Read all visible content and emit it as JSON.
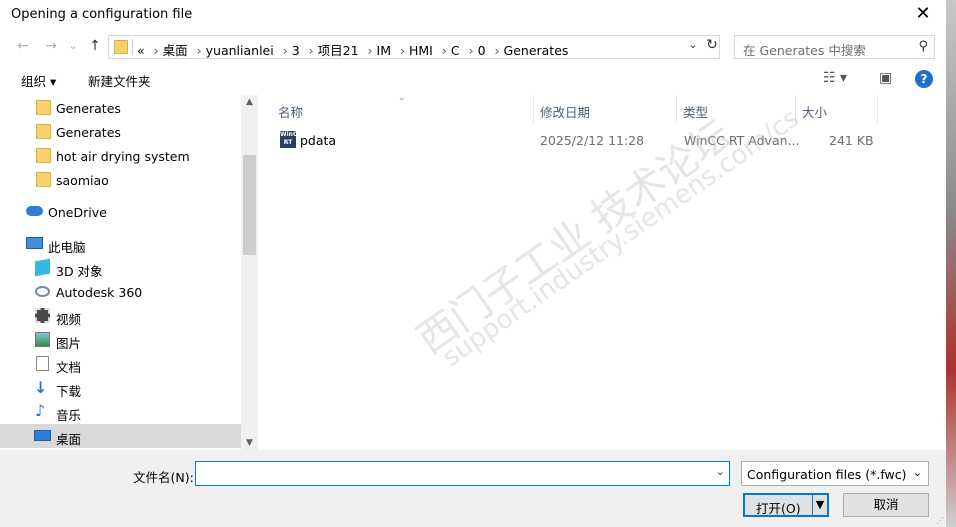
{
  "window": {
    "title": "Opening a configuration file",
    "close_glyph": "✕"
  },
  "navbar": {
    "back_glyph": "←",
    "forward_glyph": "→",
    "recent_glyph": "⌄",
    "up_glyph": "↑",
    "breadcrumbs": [
      "«",
      "桌面",
      "yuanlianlei",
      "3",
      "项目21",
      "IM",
      "HMI",
      "C",
      "0",
      "Generates"
    ],
    "search_placeholder": "在 Generates 中搜索"
  },
  "toolbar": {
    "organize_label": "组织 ▾",
    "new_folder_label": "新建文件夹"
  },
  "nav_items": [
    {
      "label": "Generates",
      "icon": "folder-icon"
    },
    {
      "label": "Generates",
      "icon": "folder-icon"
    },
    {
      "label": "hot air drying system",
      "icon": "folder-icon"
    },
    {
      "label": "saomiao",
      "icon": "folder-icon"
    },
    {
      "label": "OneDrive",
      "icon": "cloud-icon"
    },
    {
      "label": "此电脑",
      "icon": "computer-icon"
    },
    {
      "label": "3D 对象",
      "icon": "cube-icon"
    },
    {
      "label": "Autodesk 360",
      "icon": "autodesk-icon"
    },
    {
      "label": "视频",
      "icon": "video-icon"
    },
    {
      "label": "图片",
      "icon": "picture-icon"
    },
    {
      "label": "文档",
      "icon": "document-icon"
    },
    {
      "label": "下载",
      "icon": "download-icon"
    },
    {
      "label": "音乐",
      "icon": "music-icon"
    },
    {
      "label": "桌面",
      "icon": "desktop-icon"
    }
  ],
  "columns": {
    "name": "名称",
    "modified": "修改日期",
    "type": "类型",
    "size": "大小"
  },
  "files": [
    {
      "name": "pdata",
      "modified": "2025/2/12 11:28",
      "type": "WinCC RT Advan...",
      "size": "241 KB",
      "icon_text": "WinCC RT"
    }
  ],
  "watermark": {
    "line1": "西门子工业 技术论坛",
    "line2": "support.industry.siemens.com/cs"
  },
  "bottom": {
    "filename_label": "文件名(N):",
    "filename_value": "",
    "filetype_value": "Configuration files (*.fwc)",
    "open_label": "打开(O)",
    "cancel_label": "取消"
  }
}
